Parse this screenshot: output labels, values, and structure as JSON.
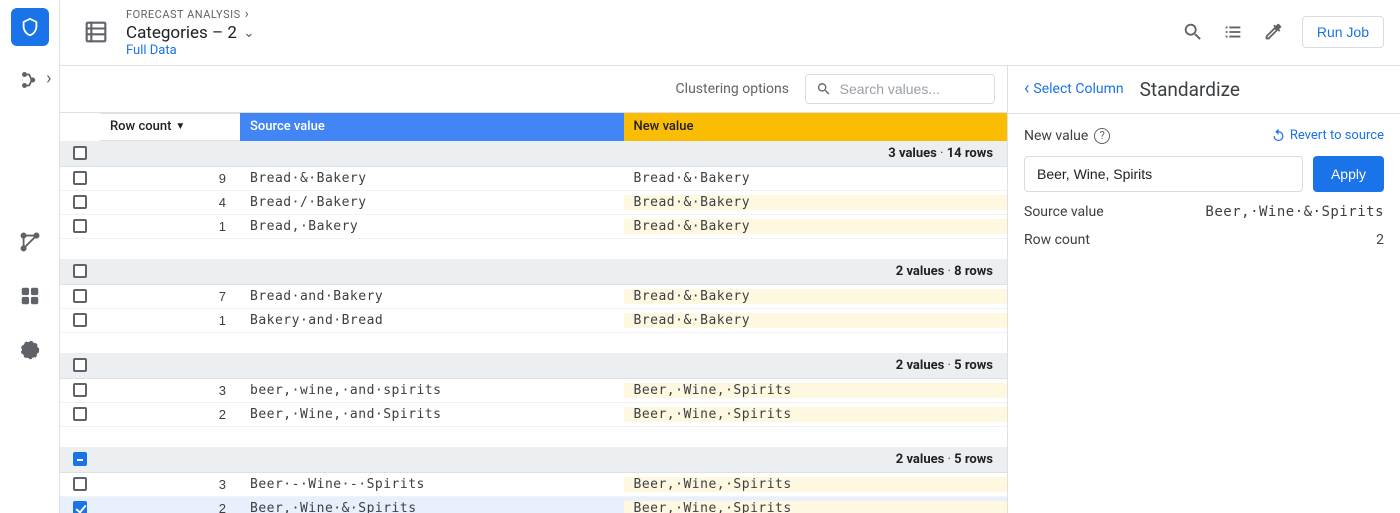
{
  "header": {
    "breadcrumb": "FORECAST ANALYSIS",
    "title": "Categories – 2",
    "subtitle": "Full Data",
    "run_button": "Run Job"
  },
  "toolbar": {
    "clustering": "Clustering options",
    "search_placeholder": "Search values..."
  },
  "columns": {
    "row_count": "Row count",
    "source_value": "Source value",
    "new_value": "New value"
  },
  "groups": [
    {
      "summary_values": "3 values",
      "summary_rows": "14 rows",
      "check_state": "unchecked",
      "rows": [
        {
          "count": "9",
          "source": "Bread·&·Bakery",
          "new": "Bread·&·Bakery",
          "changed": false,
          "checked": false
        },
        {
          "count": "4",
          "source": "Bread·/·Bakery",
          "new": "Bread·&·Bakery",
          "changed": true,
          "checked": false
        },
        {
          "count": "1",
          "source": "Bread,·Bakery",
          "new": "Bread·&·Bakery",
          "changed": true,
          "checked": false
        }
      ]
    },
    {
      "summary_values": "2 values",
      "summary_rows": "8 rows",
      "check_state": "unchecked",
      "rows": [
        {
          "count": "7",
          "source": "Bread·and·Bakery",
          "new": "Bread·&·Bakery",
          "changed": true,
          "checked": false
        },
        {
          "count": "1",
          "source": "Bakery·and·Bread",
          "new": "Bread·&·Bakery",
          "changed": true,
          "checked": false
        }
      ]
    },
    {
      "summary_values": "2 values",
      "summary_rows": "5 rows",
      "check_state": "unchecked",
      "rows": [
        {
          "count": "3",
          "source": "beer,·wine,·and·spirits",
          "new": "Beer,·Wine,·Spirits",
          "changed": true,
          "checked": false
        },
        {
          "count": "2",
          "source": "Beer,·Wine,·and·Spirits",
          "new": "Beer,·Wine,·Spirits",
          "changed": true,
          "checked": false
        }
      ]
    },
    {
      "summary_values": "2 values",
      "summary_rows": "5 rows",
      "check_state": "indeterminate",
      "rows": [
        {
          "count": "3",
          "source": "Beer·-·Wine·-·Spirits",
          "new": "Beer,·Wine,·Spirits",
          "changed": true,
          "checked": false
        },
        {
          "count": "2",
          "source": "Beer,·Wine·&·Spirits",
          "new": "Beer,·Wine,·Spirits",
          "changed": true,
          "checked": true
        }
      ]
    }
  ],
  "side": {
    "select_column": "Select Column",
    "title": "Standardize",
    "new_value_label": "New value",
    "revert": "Revert to source",
    "input_value": "Beer, Wine, Spirits",
    "apply": "Apply",
    "source_value_label": "Source value",
    "source_value": "Beer,·Wine·&·Spirits",
    "row_count_label": "Row count",
    "row_count": "2"
  }
}
